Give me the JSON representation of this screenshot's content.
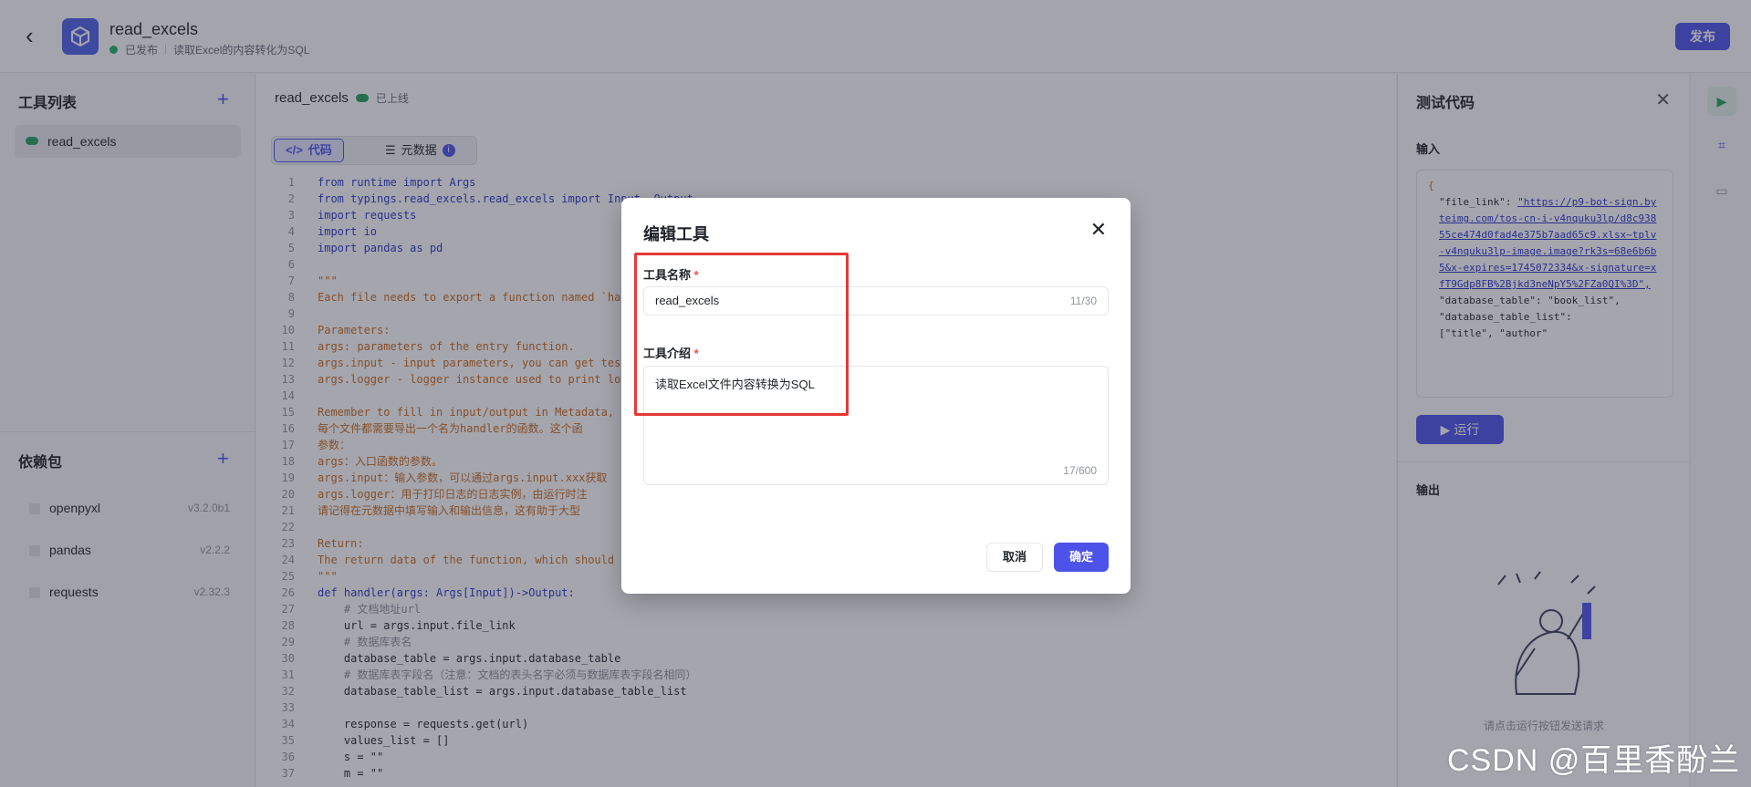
{
  "header": {
    "back_icon": "chevron-left-icon",
    "app_name": "read_excels",
    "status": "已发布",
    "description": "读取Excel的内容转化为SQL",
    "publish_label": "发布"
  },
  "sidebar": {
    "tools_title": "工具列表",
    "tools": [
      {
        "label": "read_excels"
      }
    ],
    "deps_title": "依赖包",
    "deps": [
      {
        "name": "openpyxl",
        "version": "v3.2.0b1"
      },
      {
        "name": "pandas",
        "version": "v2.2.2"
      },
      {
        "name": "requests",
        "version": "v2.32.3"
      }
    ]
  },
  "editor": {
    "tool_name": "read_excels",
    "status": "已上线",
    "tab_code": "代码",
    "tab_meta": "元数据",
    "lines": [
      "from runtime import Args",
      "from typings.read_excels.read_excels import Input, Output",
      "import requests",
      "import io",
      "import pandas as pd",
      "",
      "\"\"\"",
      "Each file needs to export a function named `handler`.",
      "",
      "Parameters:",
      "args: parameters of the entry function.",
      "args.input - input parameters, you can get test",
      "args.logger - logger instance used to print log",
      "",
      "Remember to fill in input/output in Metadata, i",
      "每个文件都需要导出一个名为handler的函数。这个函",
      "参数：",
      "args：入口函数的参数。",
      "args.input：输入参数，可以通过args.input.xxx获取",
      "args.logger：用于打印日志的日志实例，由运行时注",
      "请记得在元数据中填写输入和输出信息，这有助于大型",
      "",
      "Return:",
      "The return data of the function, which should m",
      "\"\"\"",
      "def handler(args: Args[Input])->Output:",
      "    # 文档地址url",
      "    url = args.input.file_link",
      "    # 数据库表名",
      "    database_table = args.input.database_table",
      "    # 数据库表字段名（注意：文档的表头名字必须与数据库表字段名相同）",
      "    database_table_list = args.input.database_table_list",
      "",
      "    response = requests.get(url)",
      "    values_list = []",
      "    s = \"\"",
      "    m = \"\""
    ]
  },
  "test_panel": {
    "title": "测试代码",
    "input_label": "输入",
    "json_open": "{",
    "file_link_key": "\"file_link\": ",
    "file_link_value": "\"https://p9-bot-sign.byteimg.com/tos-cn-i-v4nquku3lp/d8c93855ce474d0fad4e375b7aad65c9.xlsx~tplv-v4nquku3lp-image.image?rk3s=68e6b6b5&x-expires=1745072334&x-signature=xfT9Gdp8FB%2Bjkd3neNpY5%2FZa0QI%3D\",",
    "db_table_key": "\"database_table\": ",
    "db_table_value": "\"book_list\",",
    "db_list_key": "\"database_table_list\":",
    "db_list_value": "[\"title\", \"author\"",
    "run_label": "运行",
    "output_label": "输出",
    "hint": "请点击运行按钮发送请求"
  },
  "modal": {
    "title": "编辑工具",
    "name_label": "工具名称",
    "name_value": "read_excels",
    "name_count": "11/30",
    "desc_label": "工具介绍",
    "desc_value": "读取Excel文件内容转换为SQL",
    "desc_count": "17/600",
    "required_mark": "*",
    "cancel_label": "取消",
    "ok_label": "确定"
  },
  "watermark": "CSDN @百里香酚兰"
}
